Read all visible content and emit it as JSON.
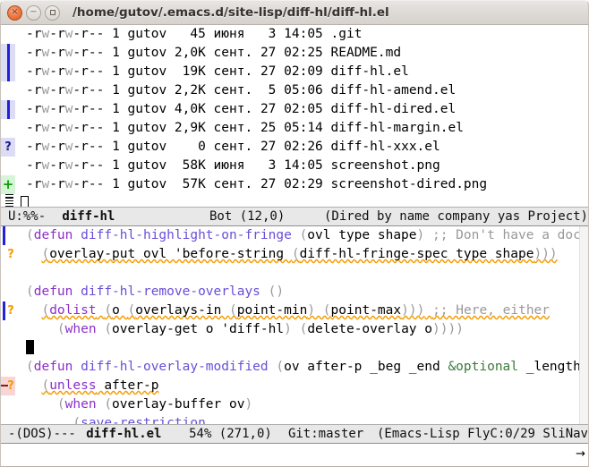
{
  "window": {
    "title": "/home/gutov/.emacs.d/site-lisp/diff-hl/diff-hl.el",
    "controls": {
      "close": "×",
      "minimize": "−",
      "maximize": "maximize-square"
    }
  },
  "dired": {
    "rows": [
      {
        "fringe": "none",
        "perms": "-rw-rw-r--",
        "links": "1",
        "owner": "gutov",
        "size": "45",
        "month": "июня",
        "day": "3",
        "time": "14:05",
        "name": ".git"
      },
      {
        "fringe": "change",
        "perms": "-rw-rw-r--",
        "links": "1",
        "owner": "gutov",
        "size": "2,0K",
        "month": "сент.",
        "day": "27",
        "time": "02:25",
        "name": "README.md"
      },
      {
        "fringe": "change",
        "perms": "-rw-rw-r--",
        "links": "1",
        "owner": "gutov",
        "size": "19K",
        "month": "сент.",
        "day": "27",
        "time": "02:09",
        "name": "diff-hl.el"
      },
      {
        "fringe": "none",
        "perms": "-rw-rw-r--",
        "links": "1",
        "owner": "gutov",
        "size": "2,2K",
        "month": "сент.",
        "day": "5",
        "time": "05:06",
        "name": "diff-hl-amend.el"
      },
      {
        "fringe": "change",
        "perms": "-rw-rw-r--",
        "links": "1",
        "owner": "gutov",
        "size": "4,0K",
        "month": "сент.",
        "day": "27",
        "time": "02:05",
        "name": "diff-hl-dired.el"
      },
      {
        "fringe": "none",
        "perms": "-rw-rw-r--",
        "links": "1",
        "owner": "gutov",
        "size": "2,9K",
        "month": "сент.",
        "day": "25",
        "time": "05:14",
        "name": "diff-hl-margin.el"
      },
      {
        "fringe": "unknown",
        "perms": "-rw-rw-r--",
        "links": "1",
        "owner": "gutov",
        "size": "0",
        "month": "сент.",
        "day": "27",
        "time": "02:26",
        "name": "diff-hl-xxx.el"
      },
      {
        "fringe": "none",
        "perms": "-rw-rw-r--",
        "links": "1",
        "owner": "gutov",
        "size": "58K",
        "month": "июня",
        "day": "3",
        "time": "14:05",
        "name": "screenshot.png"
      },
      {
        "fringe": "insert",
        "perms": "-rw-rw-r--",
        "links": "1",
        "owner": "gutov",
        "size": "57K",
        "month": "сент.",
        "day": "27",
        "time": "02:29",
        "name": "screenshot-dired.png"
      }
    ],
    "fringe_glyphs": {
      "unknown": "?",
      "insert": "+"
    }
  },
  "modeline_dired": {
    "flags": "U:%%-",
    "buffer": "diff-hl",
    "position": "Bot (12,0)",
    "modes": "(Dired by name company yas Project)"
  },
  "code": {
    "lines": [
      {
        "fringe": "change",
        "tokens": [
          {
            "t": "(",
            "c": "paren"
          },
          {
            "t": "defun",
            "c": "kw"
          },
          {
            "t": " ",
            "c": "plain"
          },
          {
            "t": "diff-hl-highlight-on-fringe",
            "c": "fname"
          },
          {
            "t": " ",
            "c": "plain"
          },
          {
            "t": "(",
            "c": "paren"
          },
          {
            "t": "ovl type shape",
            "c": "plain"
          },
          {
            "t": ")",
            "c": "paren"
          },
          {
            "t": " ",
            "c": "plain"
          },
          {
            "t": ";; Don't have a docstring",
            "c": "cmt"
          }
        ]
      },
      {
        "fringe": "flycheck",
        "tokens": [
          {
            "t": "  ",
            "c": "plain"
          },
          {
            "t": "(",
            "c": "paren",
            "u": true
          },
          {
            "t": "overlay-put ovl 'before-string ",
            "c": "plain",
            "u": true
          },
          {
            "t": "(",
            "c": "paren",
            "u": true
          },
          {
            "t": "diff-hl-fringe-spec type shape",
            "c": "plain",
            "u": true
          },
          {
            "t": ")))",
            "c": "paren",
            "u": true
          }
        ]
      },
      {
        "fringe": "none",
        "tokens": []
      },
      {
        "fringe": "none",
        "tokens": [
          {
            "t": "(",
            "c": "paren"
          },
          {
            "t": "defun",
            "c": "kw"
          },
          {
            "t": " ",
            "c": "plain"
          },
          {
            "t": "diff-hl-remove-overlays",
            "c": "fname"
          },
          {
            "t": " ",
            "c": "plain"
          },
          {
            "t": "()",
            "c": "paren"
          }
        ]
      },
      {
        "fringe": "change-flycheck",
        "tokens": [
          {
            "t": "  ",
            "c": "plain"
          },
          {
            "t": "(",
            "c": "paren",
            "u": true
          },
          {
            "t": "dolist",
            "c": "kw",
            "u": true
          },
          {
            "t": " ",
            "c": "plain",
            "u": true
          },
          {
            "t": "(",
            "c": "paren",
            "u": true
          },
          {
            "t": "o ",
            "c": "plain",
            "u": true
          },
          {
            "t": "(",
            "c": "paren",
            "u": true
          },
          {
            "t": "overlays-in ",
            "c": "plain",
            "u": true
          },
          {
            "t": "(",
            "c": "paren",
            "u": true
          },
          {
            "t": "point-min",
            "c": "plain",
            "u": true
          },
          {
            "t": ") (",
            "c": "paren",
            "u": true
          },
          {
            "t": "point-max",
            "c": "plain",
            "u": true
          },
          {
            "t": ")))",
            "c": "paren",
            "u": true
          },
          {
            "t": " ",
            "c": "plain",
            "u": true
          },
          {
            "t": ";; Here, either",
            "c": "cmt",
            "u": true
          }
        ]
      },
      {
        "fringe": "none",
        "tokens": [
          {
            "t": "    ",
            "c": "plain"
          },
          {
            "t": "(",
            "c": "paren"
          },
          {
            "t": "when",
            "c": "kw"
          },
          {
            "t": " ",
            "c": "plain"
          },
          {
            "t": "(",
            "c": "paren"
          },
          {
            "t": "overlay-get o 'diff-hl",
            "c": "plain"
          },
          {
            "t": ") (",
            "c": "paren"
          },
          {
            "t": "delete-overlay o",
            "c": "plain"
          },
          {
            "t": "))))",
            "c": "paren"
          }
        ]
      },
      {
        "fringe": "none",
        "cursor": true,
        "tokens": []
      },
      {
        "fringe": "none",
        "tokens": [
          {
            "t": "(",
            "c": "paren"
          },
          {
            "t": "defun",
            "c": "kw"
          },
          {
            "t": " ",
            "c": "plain"
          },
          {
            "t": "diff-hl-overlay-modified",
            "c": "fname"
          },
          {
            "t": " ",
            "c": "plain"
          },
          {
            "t": "(",
            "c": "paren"
          },
          {
            "t": "ov after-p _beg _end ",
            "c": "plain"
          },
          {
            "t": "&optional",
            "c": "optn"
          },
          {
            "t": " _length",
            "c": "plain"
          },
          {
            "t": ")",
            "c": "paren"
          }
        ]
      },
      {
        "fringe": "delete-flycheck",
        "tokens": [
          {
            "t": "  ",
            "c": "plain"
          },
          {
            "t": "(",
            "c": "paren",
            "u": true
          },
          {
            "t": "unless",
            "c": "kw",
            "u": true
          },
          {
            "t": " after-p",
            "c": "plain",
            "u": true
          }
        ]
      },
      {
        "fringe": "none",
        "tokens": [
          {
            "t": "    ",
            "c": "plain"
          },
          {
            "t": "(",
            "c": "paren"
          },
          {
            "t": "when",
            "c": "kw"
          },
          {
            "t": " ",
            "c": "plain"
          },
          {
            "t": "(",
            "c": "paren"
          },
          {
            "t": "overlay-buffer ov",
            "c": "plain"
          },
          {
            "t": ")",
            "c": "paren"
          }
        ]
      },
      {
        "fringe": "none",
        "tokens": [
          {
            "t": "      ",
            "c": "plain"
          },
          {
            "t": "(",
            "c": "paren"
          },
          {
            "t": "save-restriction",
            "c": "fname"
          }
        ]
      }
    ],
    "fringe_glyphs": {
      "flycheck": "?"
    }
  },
  "modeline_code": {
    "flags": "-(DOS)---",
    "buffer": "diff-hl.el",
    "position": "54% (271,0)",
    "vc": "Git:master",
    "modes": "(Emacs-Lisp FlyC:0/29 SliNav"
  },
  "echo": {
    "truncation_arrow": "→"
  },
  "colors": {
    "fringe_change": "#2020dd",
    "fringe_insert": "#0aa00a",
    "fringe_delete": "#8b1a1a",
    "flycheck_warning": "#f59b00",
    "keyword": "#8b2fc9",
    "function_name": "#6a4fd8",
    "comment": "#999999",
    "optional": "#3a7a3a",
    "titlebar_close": "#ef7b45"
  }
}
